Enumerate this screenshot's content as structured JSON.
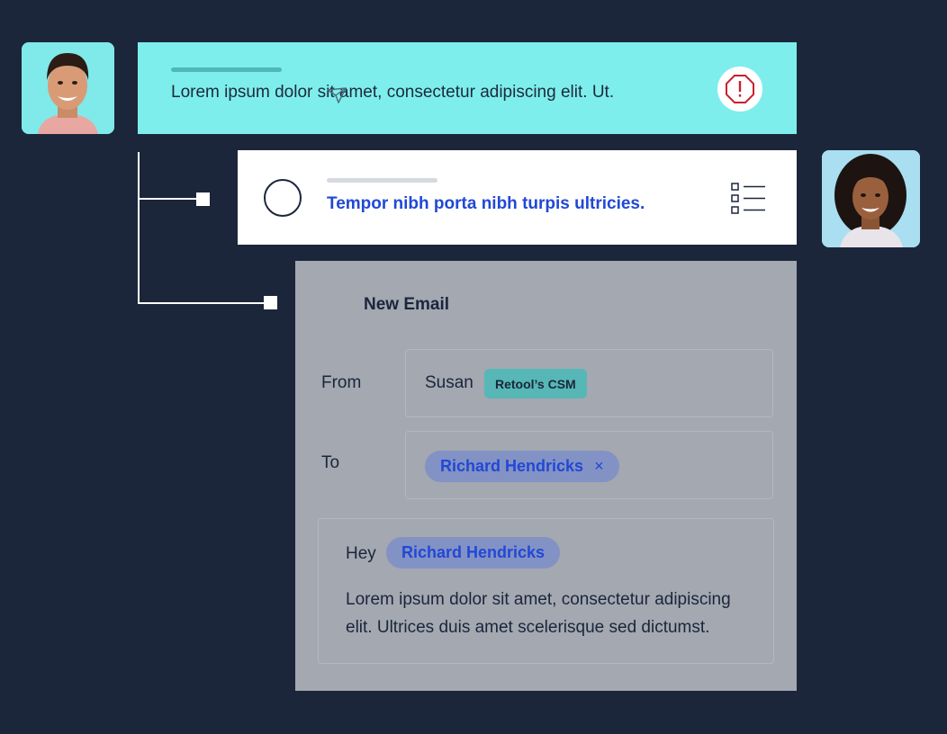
{
  "alert": {
    "text": "Lorem ipsum dolor sit amet, consectetur adipiscing elit. Ut.",
    "icon": "alert-octagon-icon",
    "accent": "#7eeeed",
    "icon_color": "#c8202e"
  },
  "task": {
    "text": "Tempor nibh porta nibh turpis ultricies.",
    "icon": "list-icon",
    "text_color": "#2148d6"
  },
  "email": {
    "title": "New Email",
    "from_label": "From",
    "from_name": "Susan",
    "from_tag": "Retool’s CSM",
    "to_label": "To",
    "to_chip": "Richard Hendricks",
    "to_chip_remove": "×",
    "greeting": "Hey",
    "mention": "Richard Hendricks",
    "body": "Lorem ipsum dolor sit amet, consectetur adipiscing elit. Ultrices duis amet scelerisque sed dictumst."
  },
  "colors": {
    "background": "#1b263b",
    "panel": "#a3a8b1",
    "chip": "#8392c4",
    "tag": "#56b7b6"
  }
}
